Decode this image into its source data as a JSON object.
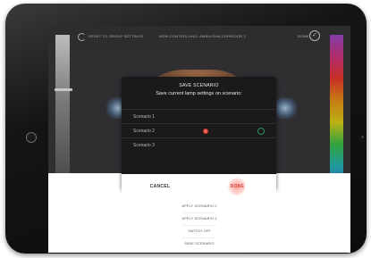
{
  "topbar": {
    "reset_label": "RESET TO GROUP SETTINGS",
    "now_controlling": "NOW CONTROLLING: AMBILIGHA CORRIDOR 2",
    "done_label": "DONE",
    "reset_icon": "rotate-ccw-icon",
    "done_icon": "check-circle-icon"
  },
  "dialog": {
    "title": "SAVE SCENARIO",
    "subtitle": "Save current lamp settings on scenario:",
    "scenarios": [
      {
        "label": "Scenario 1"
      },
      {
        "label": "Scenario 2"
      },
      {
        "label": "Scenario 3"
      }
    ],
    "selected_index": 1,
    "cancel_label": "CANCEL",
    "done_label": "DONE"
  },
  "actions": [
    {
      "label": "APPLY SCENARIO 2"
    },
    {
      "label": "APPLY SCENARIO 3"
    },
    {
      "label": "SWITCH OFF"
    },
    {
      "label": "SAVE SCENARIO"
    }
  ],
  "colors": {
    "accent": "#e0453a",
    "dialog_bg": "#1a1a1b",
    "check": "#2f8f63"
  }
}
